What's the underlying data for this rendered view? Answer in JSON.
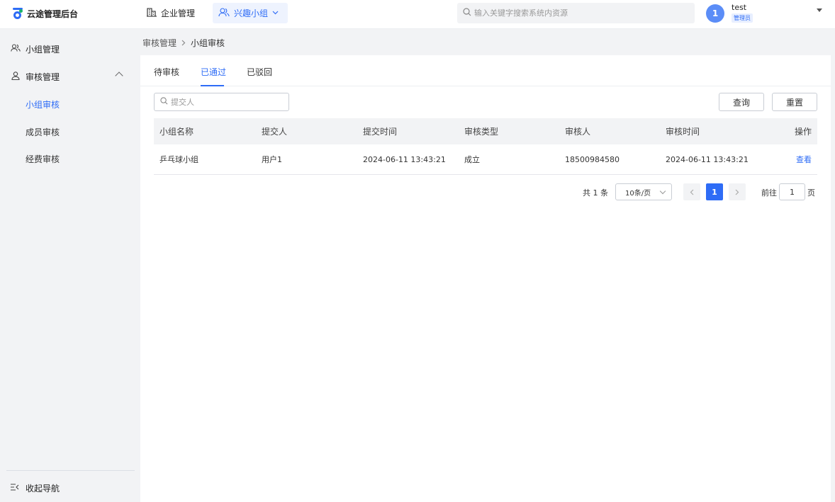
{
  "app": {
    "title": "云途管理后台"
  },
  "header": {
    "nav": [
      {
        "label": "企业管理",
        "icon": "building-icon"
      },
      {
        "label": "兴趣小组",
        "icon": "group-icon"
      }
    ],
    "search_placeholder": "输入关键字搜索系统内资源",
    "user": {
      "avatar_text": "1",
      "name": "test",
      "role": "管理员"
    }
  },
  "sidebar": {
    "items": [
      {
        "label": "小组管理",
        "icon": "group-icon"
      },
      {
        "label": "审核管理",
        "icon": "user-audit-icon",
        "expanded": true
      }
    ],
    "subitems": [
      {
        "label": "小组审核",
        "active": true
      },
      {
        "label": "成员审核",
        "active": false
      },
      {
        "label": "经费审核",
        "active": false
      }
    ],
    "collapse_label": "收起导航"
  },
  "breadcrumb": {
    "parent": "审核管理",
    "current": "小组审核"
  },
  "tabs": [
    {
      "label": "待审核",
      "active": false
    },
    {
      "label": "已通过",
      "active": true
    },
    {
      "label": "已驳回",
      "active": false
    }
  ],
  "filters": {
    "submitter_placeholder": "提交人",
    "query_label": "查询",
    "reset_label": "重置"
  },
  "table": {
    "columns": [
      "小组名称",
      "提交人",
      "提交时间",
      "审核类型",
      "审核人",
      "审核时间",
      "操作"
    ],
    "rows": [
      {
        "group_name": "乒乓球小组",
        "submitter": "用户1",
        "submit_time": "2024-06-11 13:43:21",
        "audit_type": "成立",
        "auditor": "18500984580",
        "audit_time": "2024-06-11 13:43:21",
        "action": "查看"
      }
    ]
  },
  "pagination": {
    "total_text": "共 1 条",
    "page_size": "10条/页",
    "current_page": "1",
    "goto_prefix": "前往",
    "goto_value": "1",
    "goto_suffix": "页"
  },
  "colors": {
    "accent": "#2e6cf6",
    "background": "#f2f3f5"
  }
}
